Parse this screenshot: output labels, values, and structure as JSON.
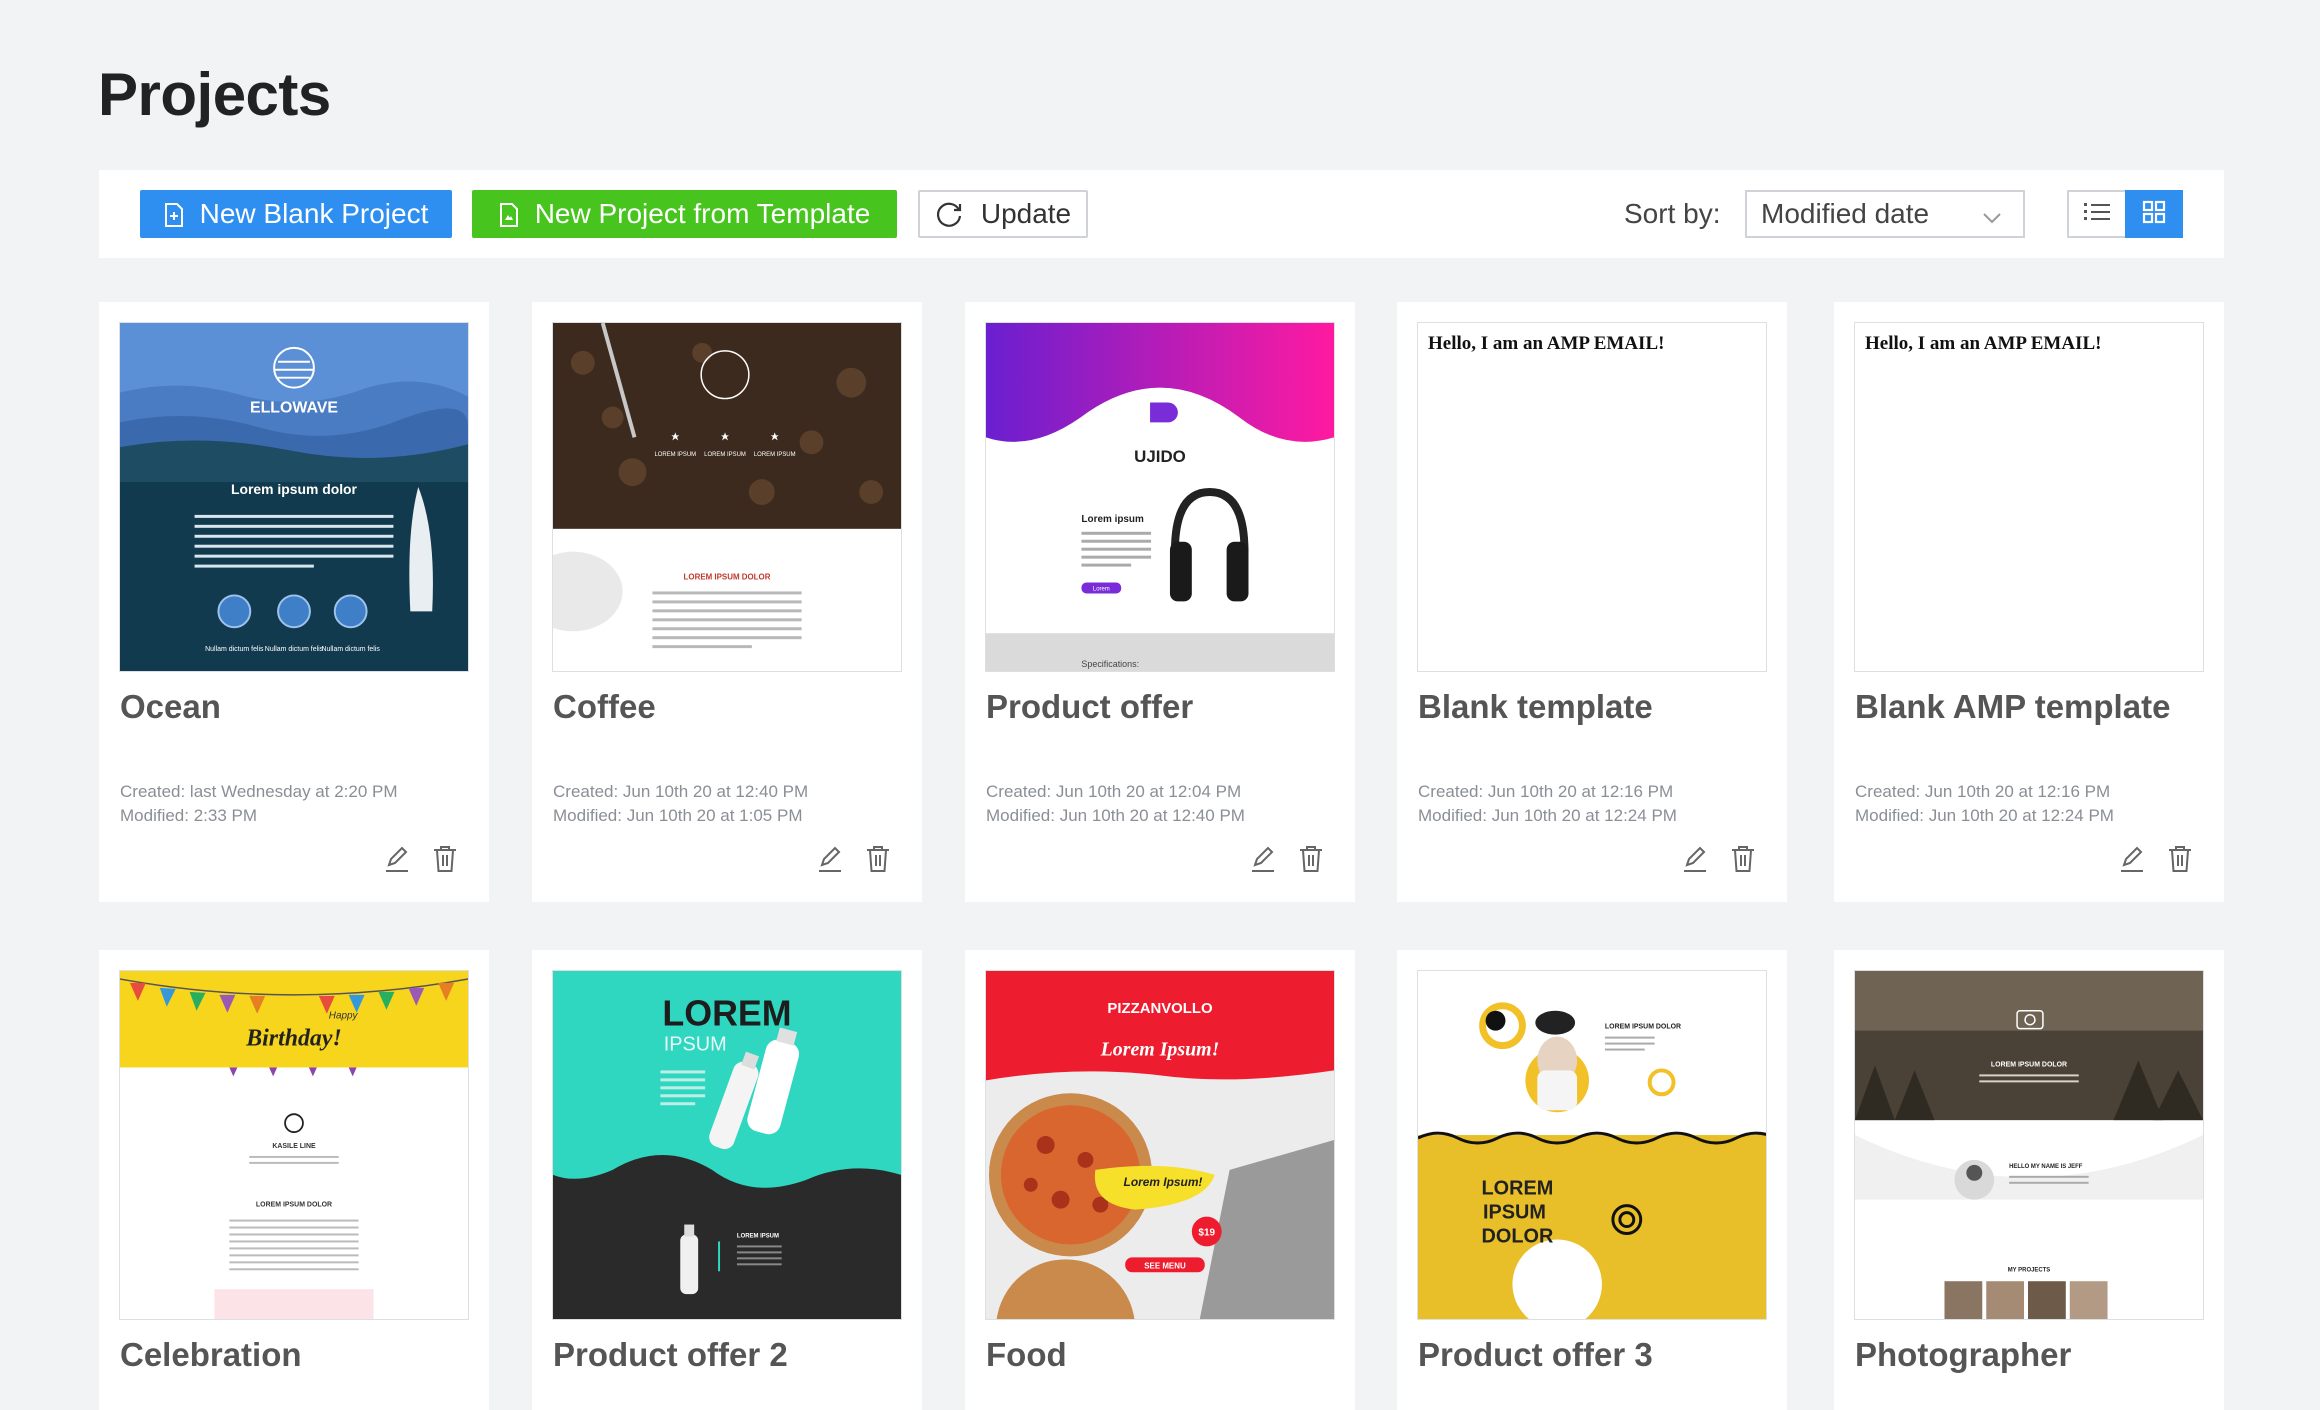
{
  "page": {
    "title": "Projects"
  },
  "toolbar": {
    "new_blank_label": "New Blank Project",
    "new_template_label": "New Project from Template",
    "update_label": "Update",
    "sort_label": "Sort by:",
    "sort_value": "Modified date"
  },
  "colors": {
    "primary": "#2e8ff0",
    "success": "#48c41e",
    "background": "#f2f3f5"
  },
  "projects": [
    {
      "title": "Ocean",
      "created": "Created: last Wednesday at 2:20 PM",
      "modified": "Modified: 2:33 PM",
      "thumb": {
        "brand": "ELLOWAVE",
        "heading": "Lorem ipsum dolor",
        "labels": [
          "Nullam dictum felis",
          "Nullam dictum felis",
          "Nullam dictum felis"
        ]
      }
    },
    {
      "title": "Coffee",
      "created": "Created: Jun 10th 20 at 12:40 PM",
      "modified": "Modified: Jun 10th 20 at 1:05 PM",
      "thumb": {
        "heading": "LOREM IPSUM DOLOR",
        "labels": [
          "LOREM IPSUM",
          "LOREM IPSUM",
          "LOREM IPSUM"
        ]
      }
    },
    {
      "title": "Product offer",
      "created": "Created: Jun 10th 20 at 12:04 PM",
      "modified": "Modified: Jun 10th 20 at 12:40 PM",
      "thumb": {
        "brand": "UJIDO",
        "heading": "Lorem ipsum",
        "button": "Lorem",
        "footer": "Specifications:"
      }
    },
    {
      "title": "Blank template",
      "created": "Created: Jun 10th 20 at 12:16 PM",
      "modified": "Modified: Jun 10th 20 at 12:24 PM",
      "thumb": {
        "heading": "Hello, I am an AMP EMAIL!"
      }
    },
    {
      "title": "Blank AMP template",
      "created": "Created: Jun 10th 20 at 12:16 PM",
      "modified": "Modified: Jun 10th 20 at 12:24 PM",
      "thumb": {
        "heading": "Hello, I am an AMP EMAIL!"
      }
    },
    {
      "title": "Celebration",
      "thumb": {
        "banner_small": "Happy",
        "banner": "Birthday!",
        "brand": "KASILE LINE",
        "heading": "LOREM IPSUM DOLOR"
      }
    },
    {
      "title": "Product offer 2",
      "thumb": {
        "heading": "LOREM",
        "subheading": "IPSUM",
        "footer": "LOREM IPSUM"
      }
    },
    {
      "title": "Food",
      "thumb": {
        "brand": "PIZZANVOLLO",
        "heading": "Lorem Ipsum!",
        "callout": "Lorem Ipsum!",
        "price": "$19",
        "button": "SEE MENU"
      }
    },
    {
      "title": "Product offer 3",
      "thumb": {
        "heading": "LOREM IPSUM DOLOR",
        "big": [
          "LOREM",
          "IPSUM",
          "DOLOR"
        ]
      }
    },
    {
      "title": "Photographer",
      "thumb": {
        "heading": "LOREM IPSUM DOLOR",
        "intro": "HELLO MY NAME IS JEFF",
        "section": "MY PROJECTS"
      }
    }
  ]
}
